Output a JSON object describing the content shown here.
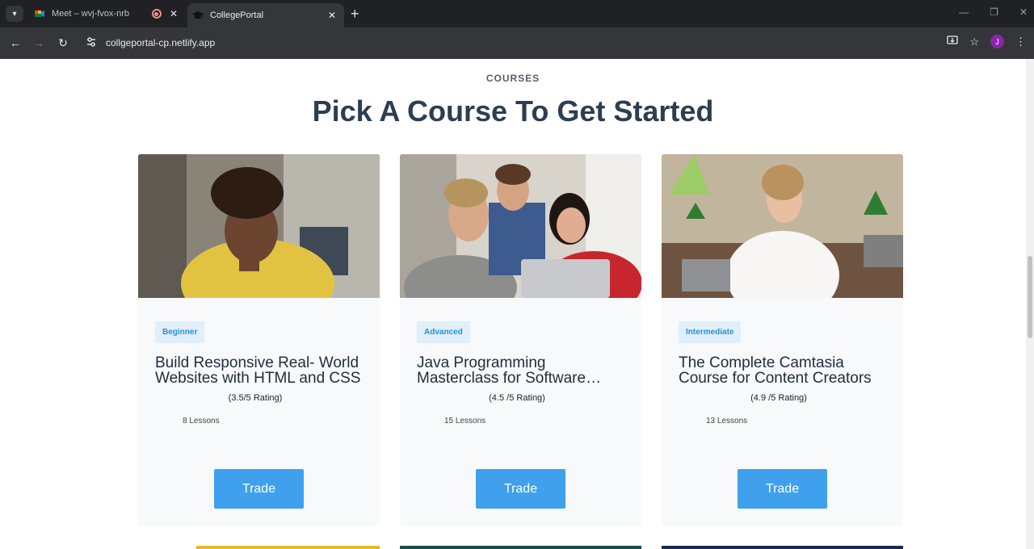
{
  "browser": {
    "tabs": [
      {
        "title": "Meet – wvj-fvox-nrb",
        "active": false,
        "recording": true
      },
      {
        "title": "CollegePortal",
        "active": true
      }
    ],
    "url": "collgeportal-cp.netlify.app",
    "profile_initial": "J"
  },
  "section": {
    "eyebrow": "COURSES",
    "title": "Pick A Course To Get Started"
  },
  "courses": [
    {
      "level": "Beginner",
      "title": "Build Responsive Real- World Websites with HTML and CSS",
      "rating": "(3.5/5 Rating)",
      "lessons": "8 Lessons",
      "button": "Trade"
    },
    {
      "level": "Advanced",
      "title": "Java Programming Masterclass for Software…",
      "rating": "(4.5 /5 Rating)",
      "lessons": "15 Lessons",
      "button": "Trade"
    },
    {
      "level": "Intermediate",
      "title": "The Complete Camtasia Course for Content Creators",
      "rating": "(4.9 /5 Rating)",
      "lessons": "13 Lessons",
      "button": "Trade"
    }
  ],
  "colors": {
    "accent": "#3fa1ee",
    "heading": "#2c3e50",
    "badge_bg": "#e0effa",
    "badge_text": "#2b8fd4"
  }
}
